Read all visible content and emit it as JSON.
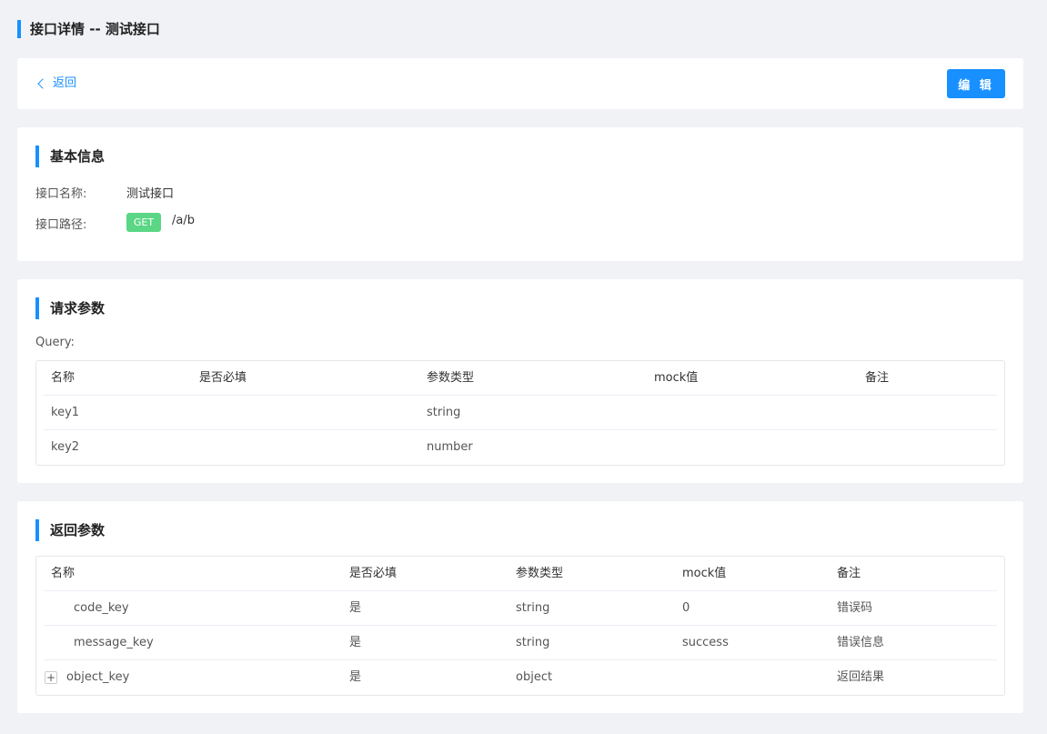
{
  "page_title": "接口详情 -- 测试接口",
  "toolbar": {
    "back_label": "返回",
    "edit_label": "编 辑"
  },
  "basic_info": {
    "title": "基本信息",
    "name_label": "接口名称:",
    "name_value": "测试接口",
    "path_label": "接口路径:",
    "method": "GET",
    "path": "/a/b",
    "method_color": "#5bd685"
  },
  "request": {
    "title": "请求参数",
    "query_label": "Query:",
    "headers": [
      "名称",
      "是否必填",
      "参数类型",
      "mock值",
      "备注"
    ],
    "rows": [
      {
        "name": "key1",
        "required": "",
        "type": "string",
        "mock": "",
        "note": ""
      },
      {
        "name": "key2",
        "required": "",
        "type": "number",
        "mock": "",
        "note": ""
      }
    ]
  },
  "response": {
    "title": "返回参数",
    "headers": [
      "名称",
      "是否必填",
      "参数类型",
      "mock值",
      "备注"
    ],
    "rows": [
      {
        "name": "code_key",
        "required": "是",
        "type": "string",
        "mock": "0",
        "note": "错误码"
      },
      {
        "name": "message_key",
        "required": "是",
        "type": "string",
        "mock": "success",
        "note": "错误信息"
      },
      {
        "name": "object_key",
        "required": "是",
        "type": "object",
        "mock": "",
        "note": "返回结果",
        "expand_symbol": "+"
      }
    ]
  },
  "colors": {
    "accent": "#1890ff",
    "background": "#f0f2f5"
  }
}
